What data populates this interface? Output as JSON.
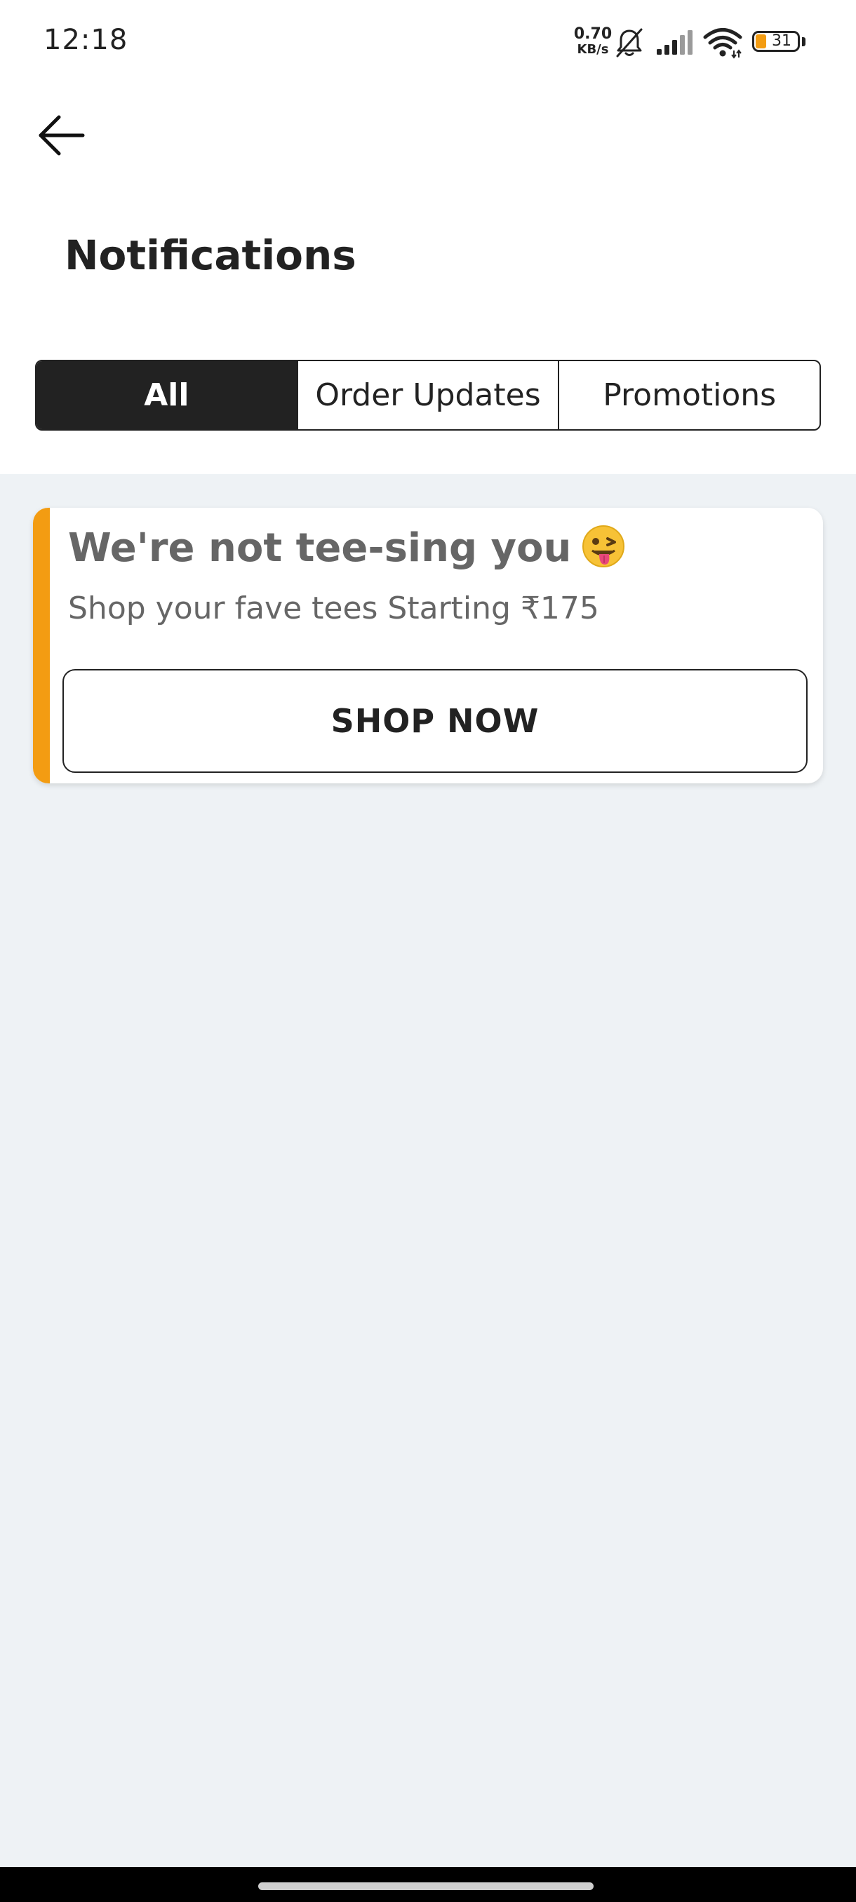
{
  "status_bar": {
    "time": "12:18",
    "net_speed_value": "0.70",
    "net_speed_unit": "KB/s",
    "battery_level": "31",
    "battery_color": "#f39c12",
    "icons": [
      "bell-muted-icon",
      "signal-icon",
      "wifi-icon",
      "battery-icon"
    ]
  },
  "header": {
    "back_icon": "arrow-left-icon",
    "title": "Notifications"
  },
  "tabs": [
    {
      "label": "All",
      "active": true
    },
    {
      "label": "Order Updates",
      "active": false
    },
    {
      "label": "Promotions",
      "active": false
    }
  ],
  "notifications": [
    {
      "title": "We're not tee-sing you",
      "emoji_icon": "winking-face-with-tongue-icon",
      "subtitle": "Shop your fave tees Starting ₹175",
      "button_label": "SHOP NOW",
      "accent_color": "#f39c12"
    }
  ],
  "colors": {
    "background": "#eef2f5",
    "active_tab": "#222222",
    "text_muted": "#666666"
  }
}
